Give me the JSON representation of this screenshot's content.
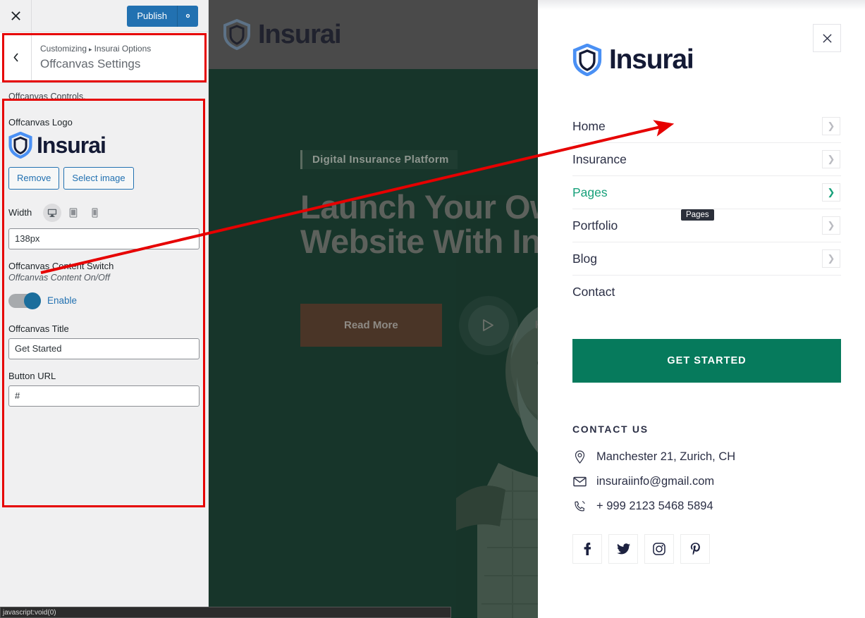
{
  "customizer": {
    "close_icon": "close-icon",
    "publish_label": "Publish",
    "gear_icon": "gear-icon",
    "back_icon": "chevron-left-icon",
    "breadcrumb_root": "Customizing",
    "breadcrumb_sep": "▸",
    "breadcrumb_parent": "Insurai Options",
    "panel_title": "Offcanvas Settings",
    "description": "Offcanvas Controls.",
    "logo_label": "Offcanvas Logo",
    "logo_text": "Insurai",
    "remove_label": "Remove",
    "select_image_label": "Select image",
    "width_label": "Width",
    "devices": [
      {
        "name": "desktop",
        "icon": "desktop-icon",
        "active": true
      },
      {
        "name": "tablet",
        "icon": "tablet-icon",
        "active": false
      },
      {
        "name": "mobile",
        "icon": "mobile-icon",
        "active": false
      }
    ],
    "width_value": "138px",
    "content_switch_label": "Offcanvas Content Switch",
    "content_switch_desc": "Offcanvas Content On/Off",
    "toggle_state": "Enable",
    "offcanvas_title_label": "Offcanvas Title",
    "offcanvas_title_value": "Get Started",
    "button_url_label": "Button URL",
    "button_url_value": "#"
  },
  "preview": {
    "header_logo_text": "Insurai",
    "eyebrow": "Digital Insurance Platform",
    "heading_line1": "Launch Your Own",
    "heading_line2": "Website With Insu",
    "read_more_label": "Read More",
    "play_icon": "play-icon",
    "how_it_works_label": "How It W",
    "status_bar": "javascript:void(0)"
  },
  "offcanvas": {
    "close_icon": "close-icon",
    "logo_text": "Insurai",
    "menu": [
      {
        "label": "Home",
        "has_arrow": true,
        "active": false
      },
      {
        "label": "Insurance",
        "has_arrow": true,
        "active": false
      },
      {
        "label": "Pages",
        "has_arrow": true,
        "active": true
      },
      {
        "label": "Portfolio",
        "has_arrow": true,
        "active": false
      },
      {
        "label": "Blog",
        "has_arrow": true,
        "active": false
      },
      {
        "label": "Contact",
        "has_arrow": false,
        "active": false
      }
    ],
    "tooltip": "Pages",
    "get_started_label": "GET STARTED",
    "contact_heading": "CONTACT US",
    "contact": [
      {
        "icon": "location-pin-icon",
        "text": "Manchester 21, Zurich, CH"
      },
      {
        "icon": "envelope-icon",
        "text": "insuraiinfo@gmail.com"
      },
      {
        "icon": "phone-icon",
        "text": "+ 999 2123 5468 5894"
      }
    ],
    "social": [
      {
        "icon": "facebook-icon",
        "glyph": "f"
      },
      {
        "icon": "twitter-icon",
        "glyph": "t"
      },
      {
        "icon": "instagram-icon",
        "glyph": "i"
      },
      {
        "icon": "pinterest-icon",
        "glyph": "p"
      }
    ]
  },
  "colors": {
    "wp_blue": "#2271b1",
    "annotation_red": "#e60000",
    "brand_green": "#067a5c",
    "active_green": "#17a07a",
    "navy": "#2b2f45",
    "preview_dark_green": "#17352a"
  }
}
